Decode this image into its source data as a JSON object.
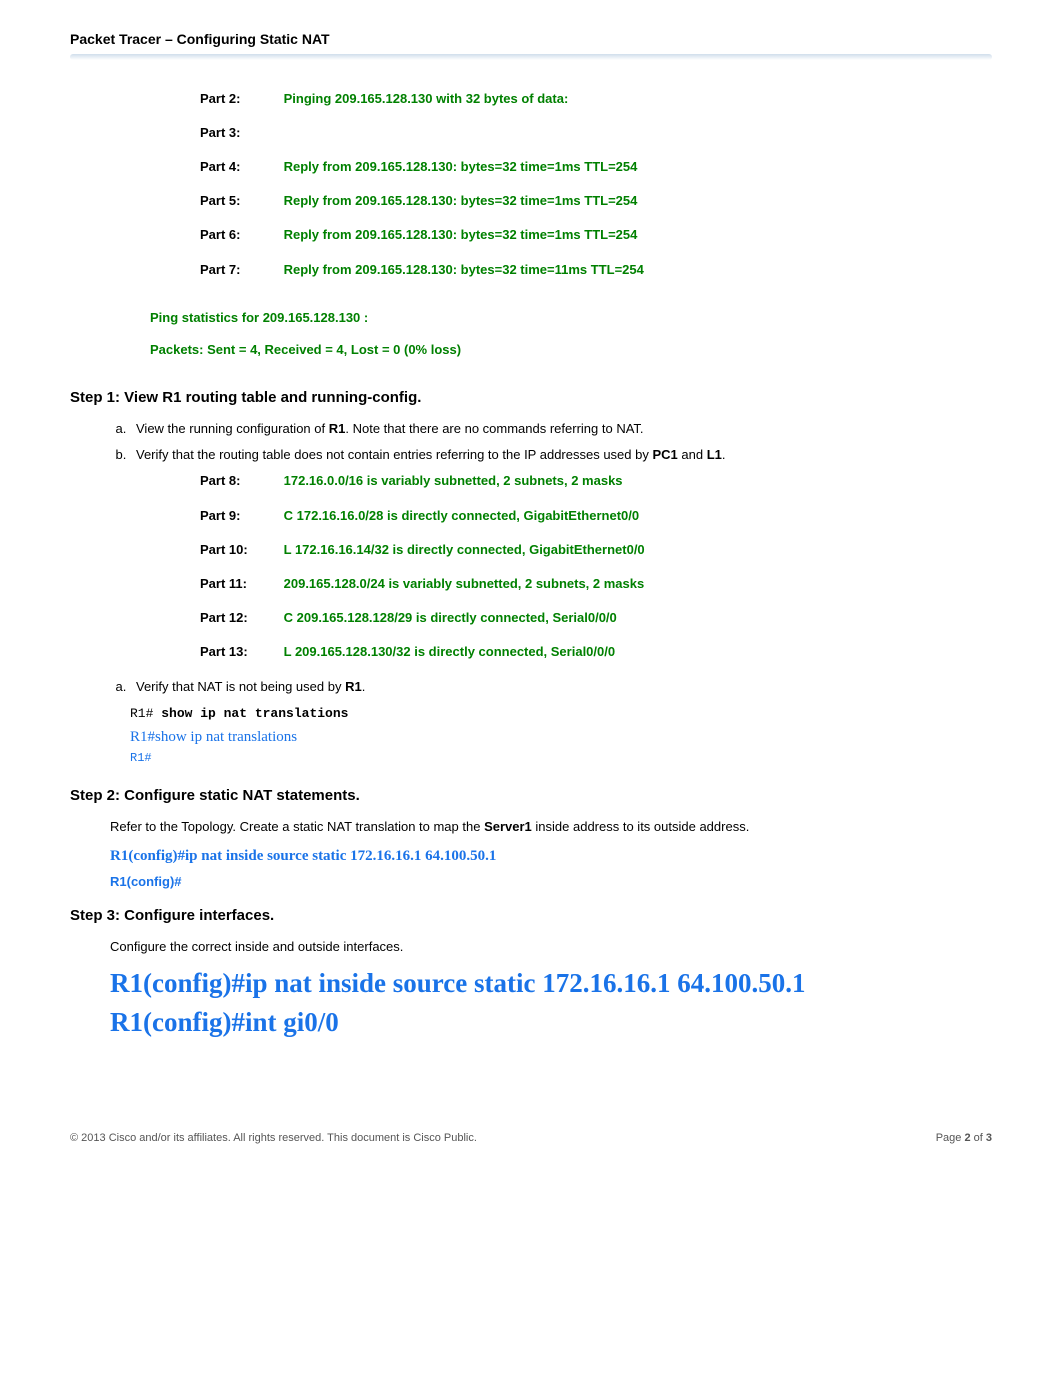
{
  "header": {
    "title": "Packet Tracer – Configuring Static NAT"
  },
  "ping_output": {
    "parts": [
      {
        "label": "Part 2:",
        "text": "Pinging 209.165.128.130 with 32 bytes of data:"
      },
      {
        "label": "Part 3:",
        "text": ""
      },
      {
        "label": "Part 4:",
        "text": "Reply from 209.165.128.130: bytes=32 time=1ms TTL=254"
      },
      {
        "label": "Part 5:",
        "text": "Reply from 209.165.128.130: bytes=32 time=1ms TTL=254"
      },
      {
        "label": "Part 6:",
        "text": "Reply from 209.165.128.130: bytes=32 time=1ms TTL=254"
      },
      {
        "label": "Part 7:",
        "text": "Reply from 209.165.128.130: bytes=32 time=11ms TTL=254"
      }
    ],
    "stats_header": "Ping statistics for 209.165.128.130 :",
    "stats_line": "Packets: Sent = 4, Received = 4, Lost = 0 (0% loss)"
  },
  "step1": {
    "title": "Step 1:   View R1 routing table and running-config.",
    "item_a_pre": "View the running configuration of ",
    "item_a_bold": "R1",
    "item_a_post": ". Note that there are no commands referring to NAT.",
    "item_b_pre": "Verify that the routing table does not contain entries referring to the IP addresses used by ",
    "item_b_bold1": "PC1",
    "item_b_mid": " and ",
    "item_b_bold2": "L1",
    "item_b_post": ".",
    "routing": [
      {
        "label": "Part 8:",
        "text": "172.16.0.0/16 is variably subnetted, 2 subnets, 2 masks"
      },
      {
        "label": "Part 9:",
        "text": "C 172.16.16.0/28 is directly connected, GigabitEthernet0/0"
      },
      {
        "label": "Part 10:",
        "text": "L 172.16.16.14/32 is directly connected, GigabitEthernet0/0"
      },
      {
        "label": "Part 11:",
        "text": "209.165.128.0/24 is variably subnetted, 2 subnets, 2 masks"
      },
      {
        "label": "Part 12:",
        "text": "C 209.165.128.128/29 is directly connected, Serial0/0/0"
      },
      {
        "label": "Part 13:",
        "text": "L 209.165.128.130/32 is directly connected, Serial0/0/0"
      }
    ],
    "verify_a_pre": "Verify that NAT is not being used by ",
    "verify_a_bold": "R1",
    "verify_a_post": ".",
    "cmd_prompt": "R1# ",
    "cmd_text": "show ip nat translations",
    "cmd_out1": "R1#show ip nat translations",
    "cmd_out2": "R1#"
  },
  "step2": {
    "title": "Step 2:   Configure static NAT statements.",
    "para_pre": "Refer to the Topology. Create a static NAT translation to map the ",
    "para_bold": "Server1",
    "para_post": " inside address to its outside address.",
    "cfg1": "R1(config)#ip nat inside source static 172.16.16.1 64.100.50.1",
    "cfg2": "R1(config)#"
  },
  "step3": {
    "title": "Step 3:   Configure interfaces.",
    "para": "Configure the correct inside and outside interfaces.",
    "big1": "R1(config)#ip nat inside source static 172.16.16.1 64.100.50.1",
    "big2": "R1(config)#int gi0/0"
  },
  "footer": {
    "left": "© 2013 Cisco and/or its affiliates. All rights reserved. This document is Cisco Public.",
    "right_pre": "Page ",
    "right_b1": "2",
    "right_mid": " of ",
    "right_b2": "3"
  }
}
